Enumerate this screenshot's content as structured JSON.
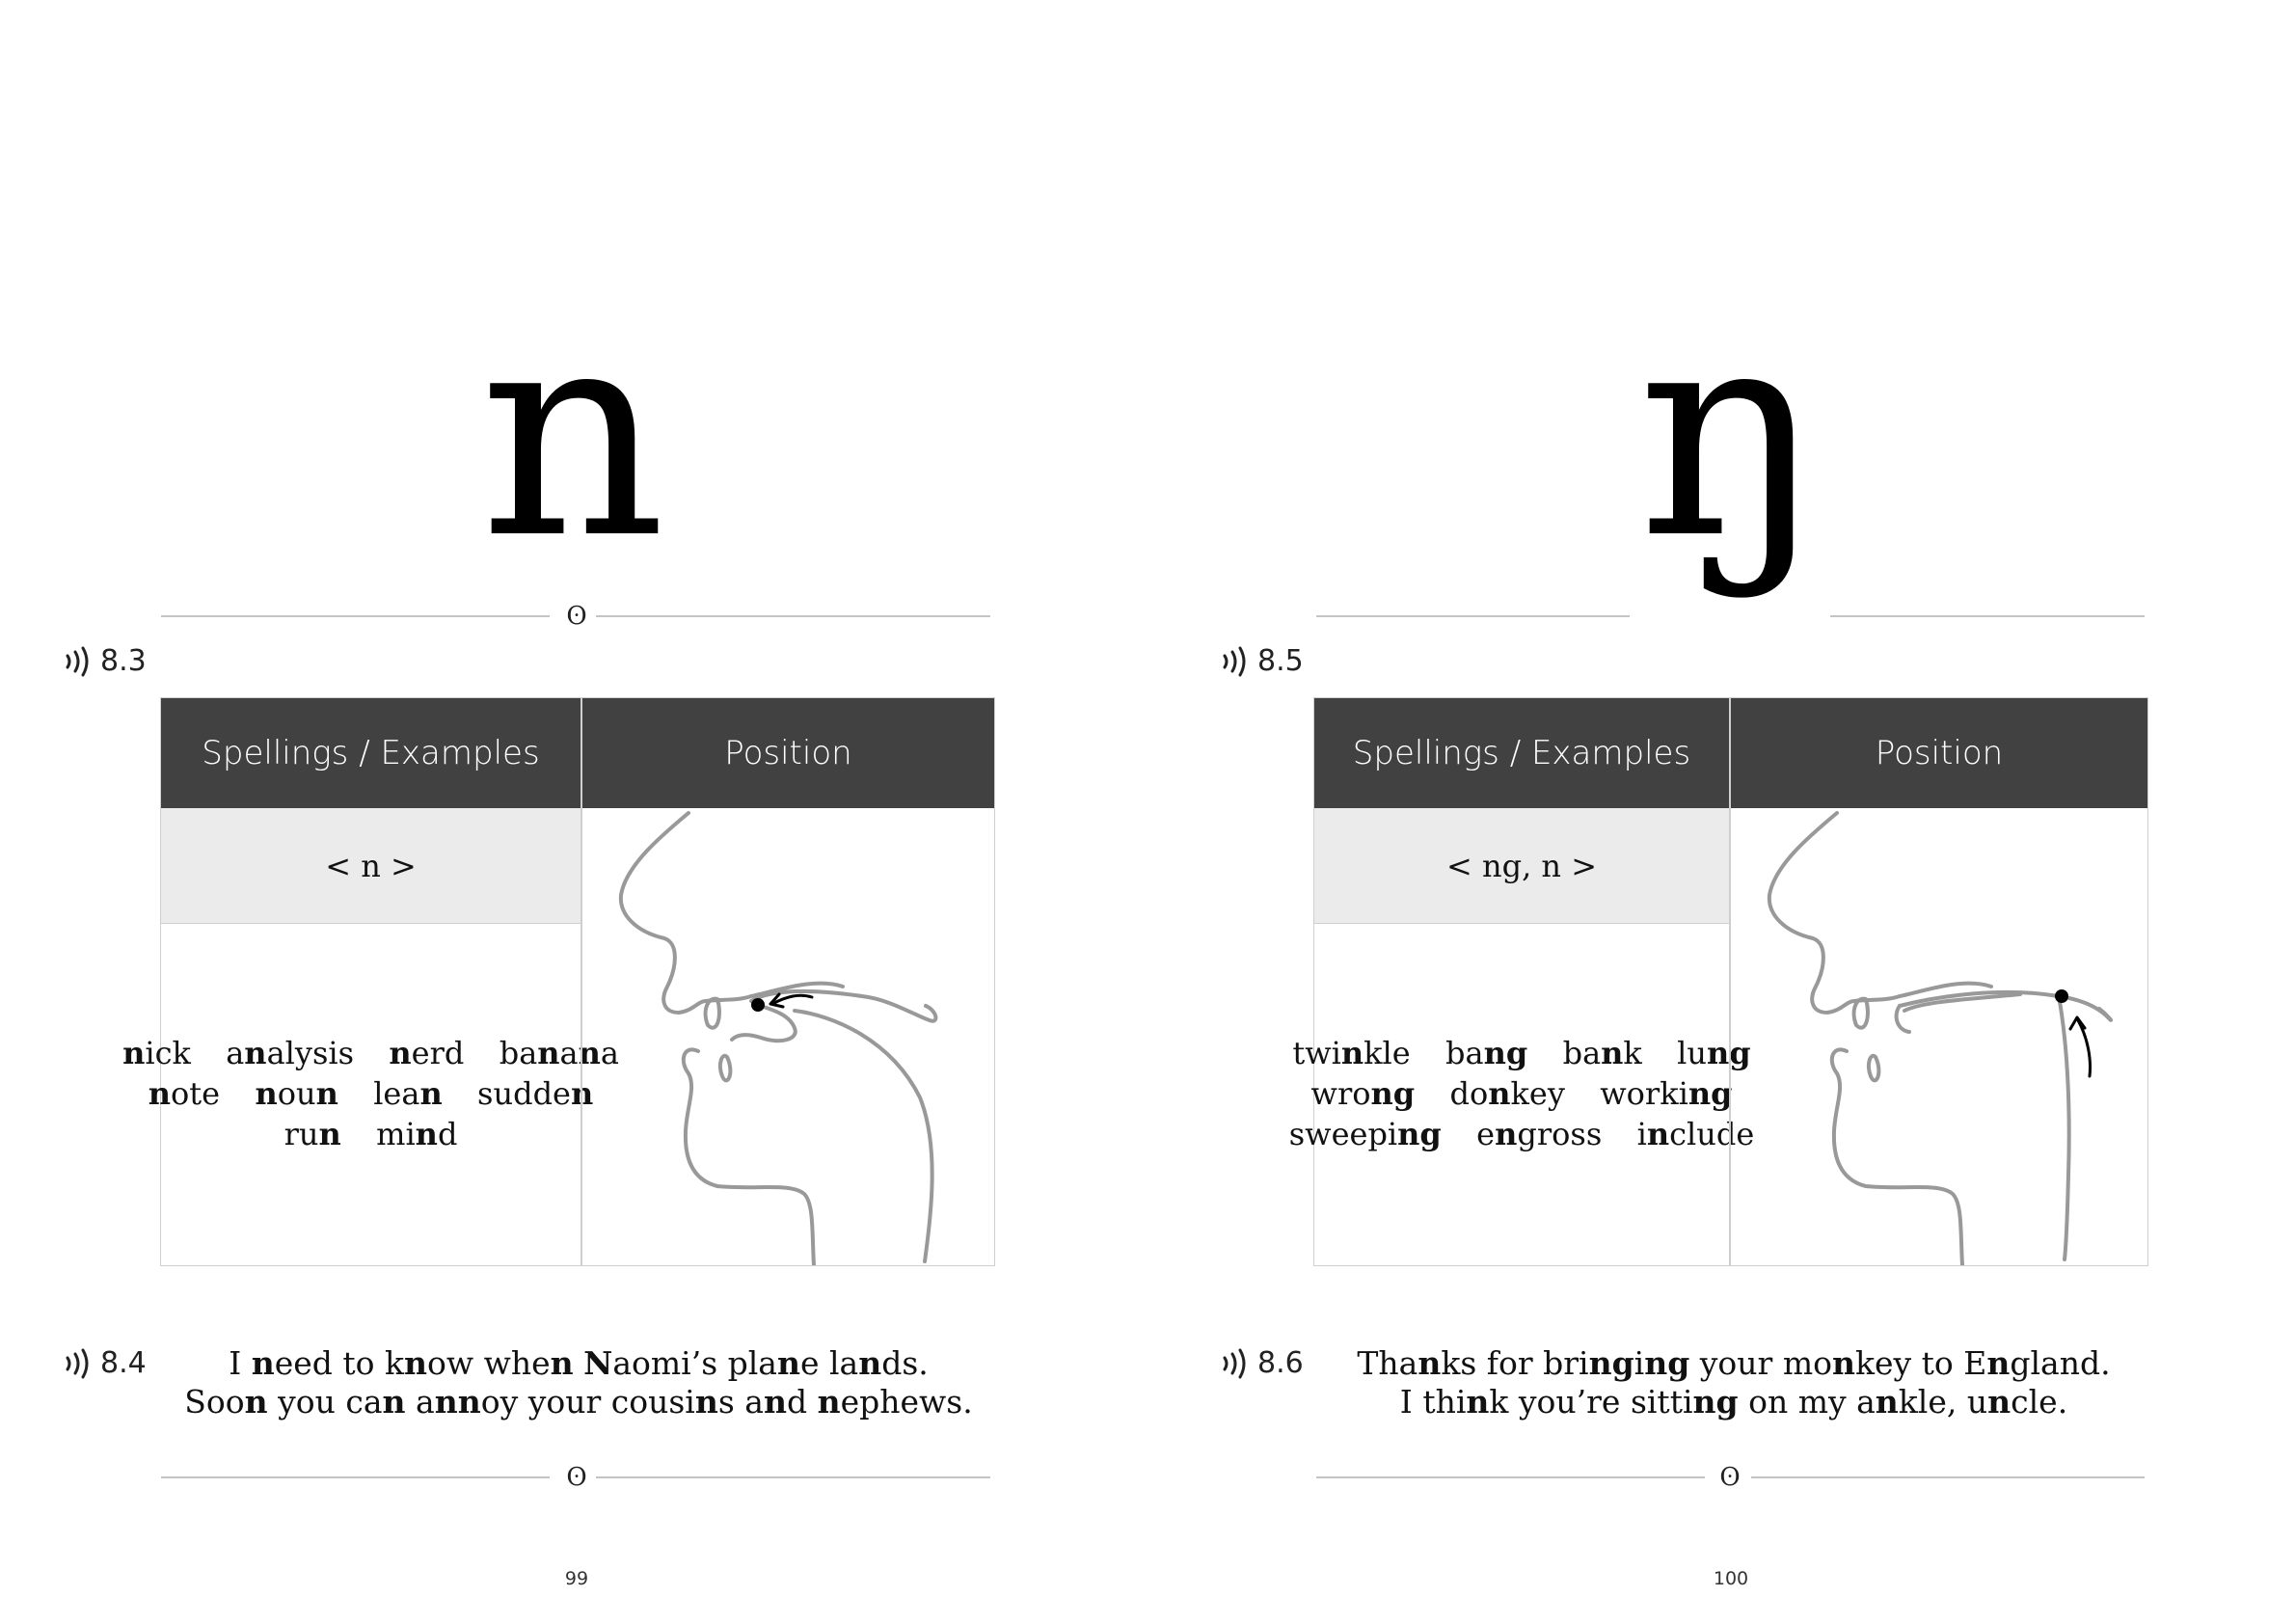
{
  "left_page": {
    "symbol": "n",
    "ornament": "ʘ",
    "audio_table": "8.3",
    "audio_sentences": "8.4",
    "table": {
      "header_spellings": "Spellings / Examples",
      "header_position": "Position",
      "spellings": "< n >",
      "examples": [
        [
          [
            "n",
            true
          ],
          [
            "ick",
            false
          ],
          [
            "  a",
            false
          ],
          [
            "n",
            true
          ],
          [
            "alysis  ",
            false
          ],
          [
            "n",
            true
          ],
          [
            "erd  ba",
            false
          ],
          [
            "n",
            true
          ],
          [
            "a",
            false
          ],
          [
            "n",
            true
          ],
          [
            "a",
            false
          ]
        ],
        [
          [
            "n",
            true
          ],
          [
            "ote  ",
            false
          ],
          [
            "n",
            true
          ],
          [
            "ou",
            false
          ],
          [
            "n",
            true
          ],
          [
            "  lea",
            false
          ],
          [
            "n",
            true
          ],
          [
            "  sudde",
            false
          ],
          [
            "n",
            true
          ]
        ],
        [
          [
            "ru",
            false
          ],
          [
            "n",
            true
          ],
          [
            "  mi",
            false
          ],
          [
            "n",
            true
          ],
          [
            "d",
            false
          ]
        ]
      ],
      "diagram_icon": "alveolar-nasal-diagram"
    },
    "sentences": [
      [
        [
          "I ",
          false
        ],
        [
          "n",
          true
        ],
        [
          "eed to k",
          false
        ],
        [
          "n",
          true
        ],
        [
          "ow whe",
          false
        ],
        [
          "n",
          true
        ],
        [
          " ",
          false
        ],
        [
          "N",
          true
        ],
        [
          "aomi’s pla",
          false
        ],
        [
          "n",
          true
        ],
        [
          "e la",
          false
        ],
        [
          "n",
          true
        ],
        [
          "ds.",
          false
        ]
      ],
      [
        [
          "Soo",
          false
        ],
        [
          "n",
          true
        ],
        [
          " you ca",
          false
        ],
        [
          "n",
          true
        ],
        [
          " a",
          false
        ],
        [
          "nn",
          true
        ],
        [
          "oy your cousi",
          false
        ],
        [
          "n",
          true
        ],
        [
          "s a",
          false
        ],
        [
          "n",
          true
        ],
        [
          "d ",
          false
        ],
        [
          "n",
          true
        ],
        [
          "ephews.",
          false
        ]
      ]
    ],
    "page_number": "99"
  },
  "right_page": {
    "symbol": "ŋ",
    "ornament": "ʘ",
    "audio_table": "8.5",
    "audio_sentences": "8.6",
    "table": {
      "header_spellings": "Spellings / Examples",
      "header_position": "Position",
      "spellings": "< ng, n >",
      "examples": [
        [
          [
            "twi",
            false
          ],
          [
            "n",
            true
          ],
          [
            "kle  ba",
            false
          ],
          [
            "ng",
            true
          ],
          [
            "  ba",
            false
          ],
          [
            "n",
            true
          ],
          [
            "k  lu",
            false
          ],
          [
            "ng",
            true
          ]
        ],
        [
          [
            "wro",
            false
          ],
          [
            "ng",
            true
          ],
          [
            "  do",
            false
          ],
          [
            "n",
            true
          ],
          [
            "key  worki",
            false
          ],
          [
            "ng",
            true
          ]
        ],
        [
          [
            "sweepi",
            false
          ],
          [
            "ng",
            true
          ],
          [
            "  e",
            false
          ],
          [
            "n",
            true
          ],
          [
            "gross  i",
            false
          ],
          [
            "n",
            true
          ],
          [
            "clude",
            false
          ]
        ]
      ],
      "diagram_icon": "velar-nasal-diagram"
    },
    "sentences": [
      [
        [
          "Tha",
          false
        ],
        [
          "n",
          true
        ],
        [
          "ks for bri",
          false
        ],
        [
          "ng",
          true
        ],
        [
          "i",
          false
        ],
        [
          "ng",
          true
        ],
        [
          " your mo",
          false
        ],
        [
          "n",
          true
        ],
        [
          "key to E",
          false
        ],
        [
          "n",
          true
        ],
        [
          "gland.",
          false
        ]
      ],
      [
        [
          "I thi",
          false
        ],
        [
          "n",
          true
        ],
        [
          "k you’re sitti",
          false
        ],
        [
          "ng",
          true
        ],
        [
          " on my a",
          false
        ],
        [
          "n",
          true
        ],
        [
          "kle, u",
          false
        ],
        [
          "n",
          true
        ],
        [
          "cle.",
          false
        ]
      ]
    ],
    "page_number": "100"
  }
}
